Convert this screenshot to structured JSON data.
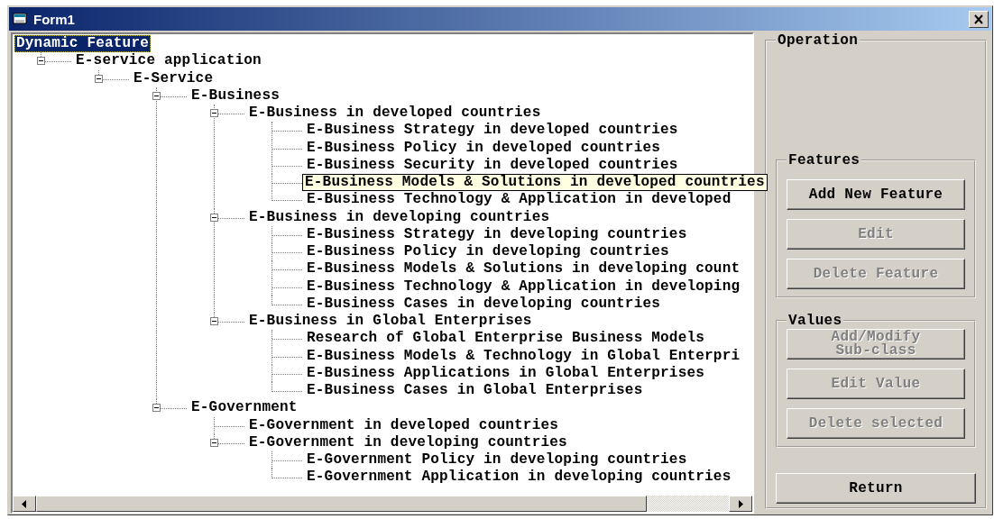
{
  "window": {
    "title": "Form1"
  },
  "tree": {
    "root": {
      "label": "Dynamic Feature",
      "selected": true,
      "hovered": false,
      "children": [
        {
          "label": "E-service application",
          "selected": false,
          "hovered": false,
          "expanded": true,
          "children": [
            {
              "label": "E-Service",
              "selected": false,
              "hovered": false,
              "expanded": true,
              "children": [
                {
                  "label": "E-Business",
                  "selected": false,
                  "hovered": false,
                  "expanded": true,
                  "children": [
                    {
                      "label": "E-Business in developed countries",
                      "selected": false,
                      "hovered": false,
                      "expanded": true,
                      "children": [
                        {
                          "label": "E-Business Strategy in developed countries",
                          "selected": false,
                          "hovered": false
                        },
                        {
                          "label": "E-Business Policy in developed countries",
                          "selected": false,
                          "hovered": false
                        },
                        {
                          "label": "E-Business Security in developed countries",
                          "selected": false,
                          "hovered": false
                        },
                        {
                          "label": "E-Business Models & Solutions in developed countries",
                          "selected": false,
                          "hovered": true
                        },
                        {
                          "label": "E-Business Technology & Application in developed",
                          "selected": false,
                          "hovered": false
                        }
                      ]
                    },
                    {
                      "label": "E-Business in developing countries",
                      "selected": false,
                      "hovered": false,
                      "expanded": true,
                      "children": [
                        {
                          "label": "E-Business Strategy in developing countries",
                          "selected": false,
                          "hovered": false
                        },
                        {
                          "label": "E-Business Policy in developing countries",
                          "selected": false,
                          "hovered": false
                        },
                        {
                          "label": "E-Business Models & Solutions in developing count",
                          "selected": false,
                          "hovered": false
                        },
                        {
                          "label": "E-Business Technology & Application in developing",
                          "selected": false,
                          "hovered": false
                        },
                        {
                          "label": "E-Business Cases in developing countries",
                          "selected": false,
                          "hovered": false
                        }
                      ]
                    },
                    {
                      "label": "E-Business in Global Enterprises",
                      "selected": false,
                      "hovered": false,
                      "expanded": true,
                      "children": [
                        {
                          "label": "Research of Global Enterprise Business Models",
                          "selected": false,
                          "hovered": false
                        },
                        {
                          "label": "E-Business Models & Technology in Global Enterpri",
                          "selected": false,
                          "hovered": false
                        },
                        {
                          "label": "E-Business Applications in Global Enterprises",
                          "selected": false,
                          "hovered": false
                        },
                        {
                          "label": "E-Business Cases in Global Enterprises",
                          "selected": false,
                          "hovered": false
                        }
                      ]
                    }
                  ]
                },
                {
                  "label": "E-Government",
                  "selected": false,
                  "hovered": false,
                  "expanded": true,
                  "children": [
                    {
                      "label": "E-Government in developed countries",
                      "selected": false,
                      "hovered": false
                    },
                    {
                      "label": "E-Government in developing countries",
                      "selected": false,
                      "hovered": false,
                      "expanded": true,
                      "children": [
                        {
                          "label": "E-Government Policy in developing countries",
                          "selected": false,
                          "hovered": false
                        },
                        {
                          "label": "E-Government Application in developing countries",
                          "selected": false,
                          "hovered": false
                        }
                      ]
                    }
                  ]
                }
              ]
            }
          ]
        }
      ]
    }
  },
  "operation": {
    "title": "Operation",
    "features": {
      "title": "Features",
      "buttons": [
        {
          "label": "Add New Feature",
          "disabled": false
        },
        {
          "label": "Edit",
          "disabled": true
        },
        {
          "label": "Delete Feature",
          "disabled": true
        }
      ]
    },
    "values": {
      "title": "Values",
      "buttons": [
        {
          "label": "Add/Modify Sub-class",
          "disabled": true
        },
        {
          "label": "Edit Value",
          "disabled": true
        },
        {
          "label": "Delete selected",
          "disabled": true
        }
      ]
    },
    "return_button": {
      "label": "Return",
      "disabled": false
    }
  }
}
